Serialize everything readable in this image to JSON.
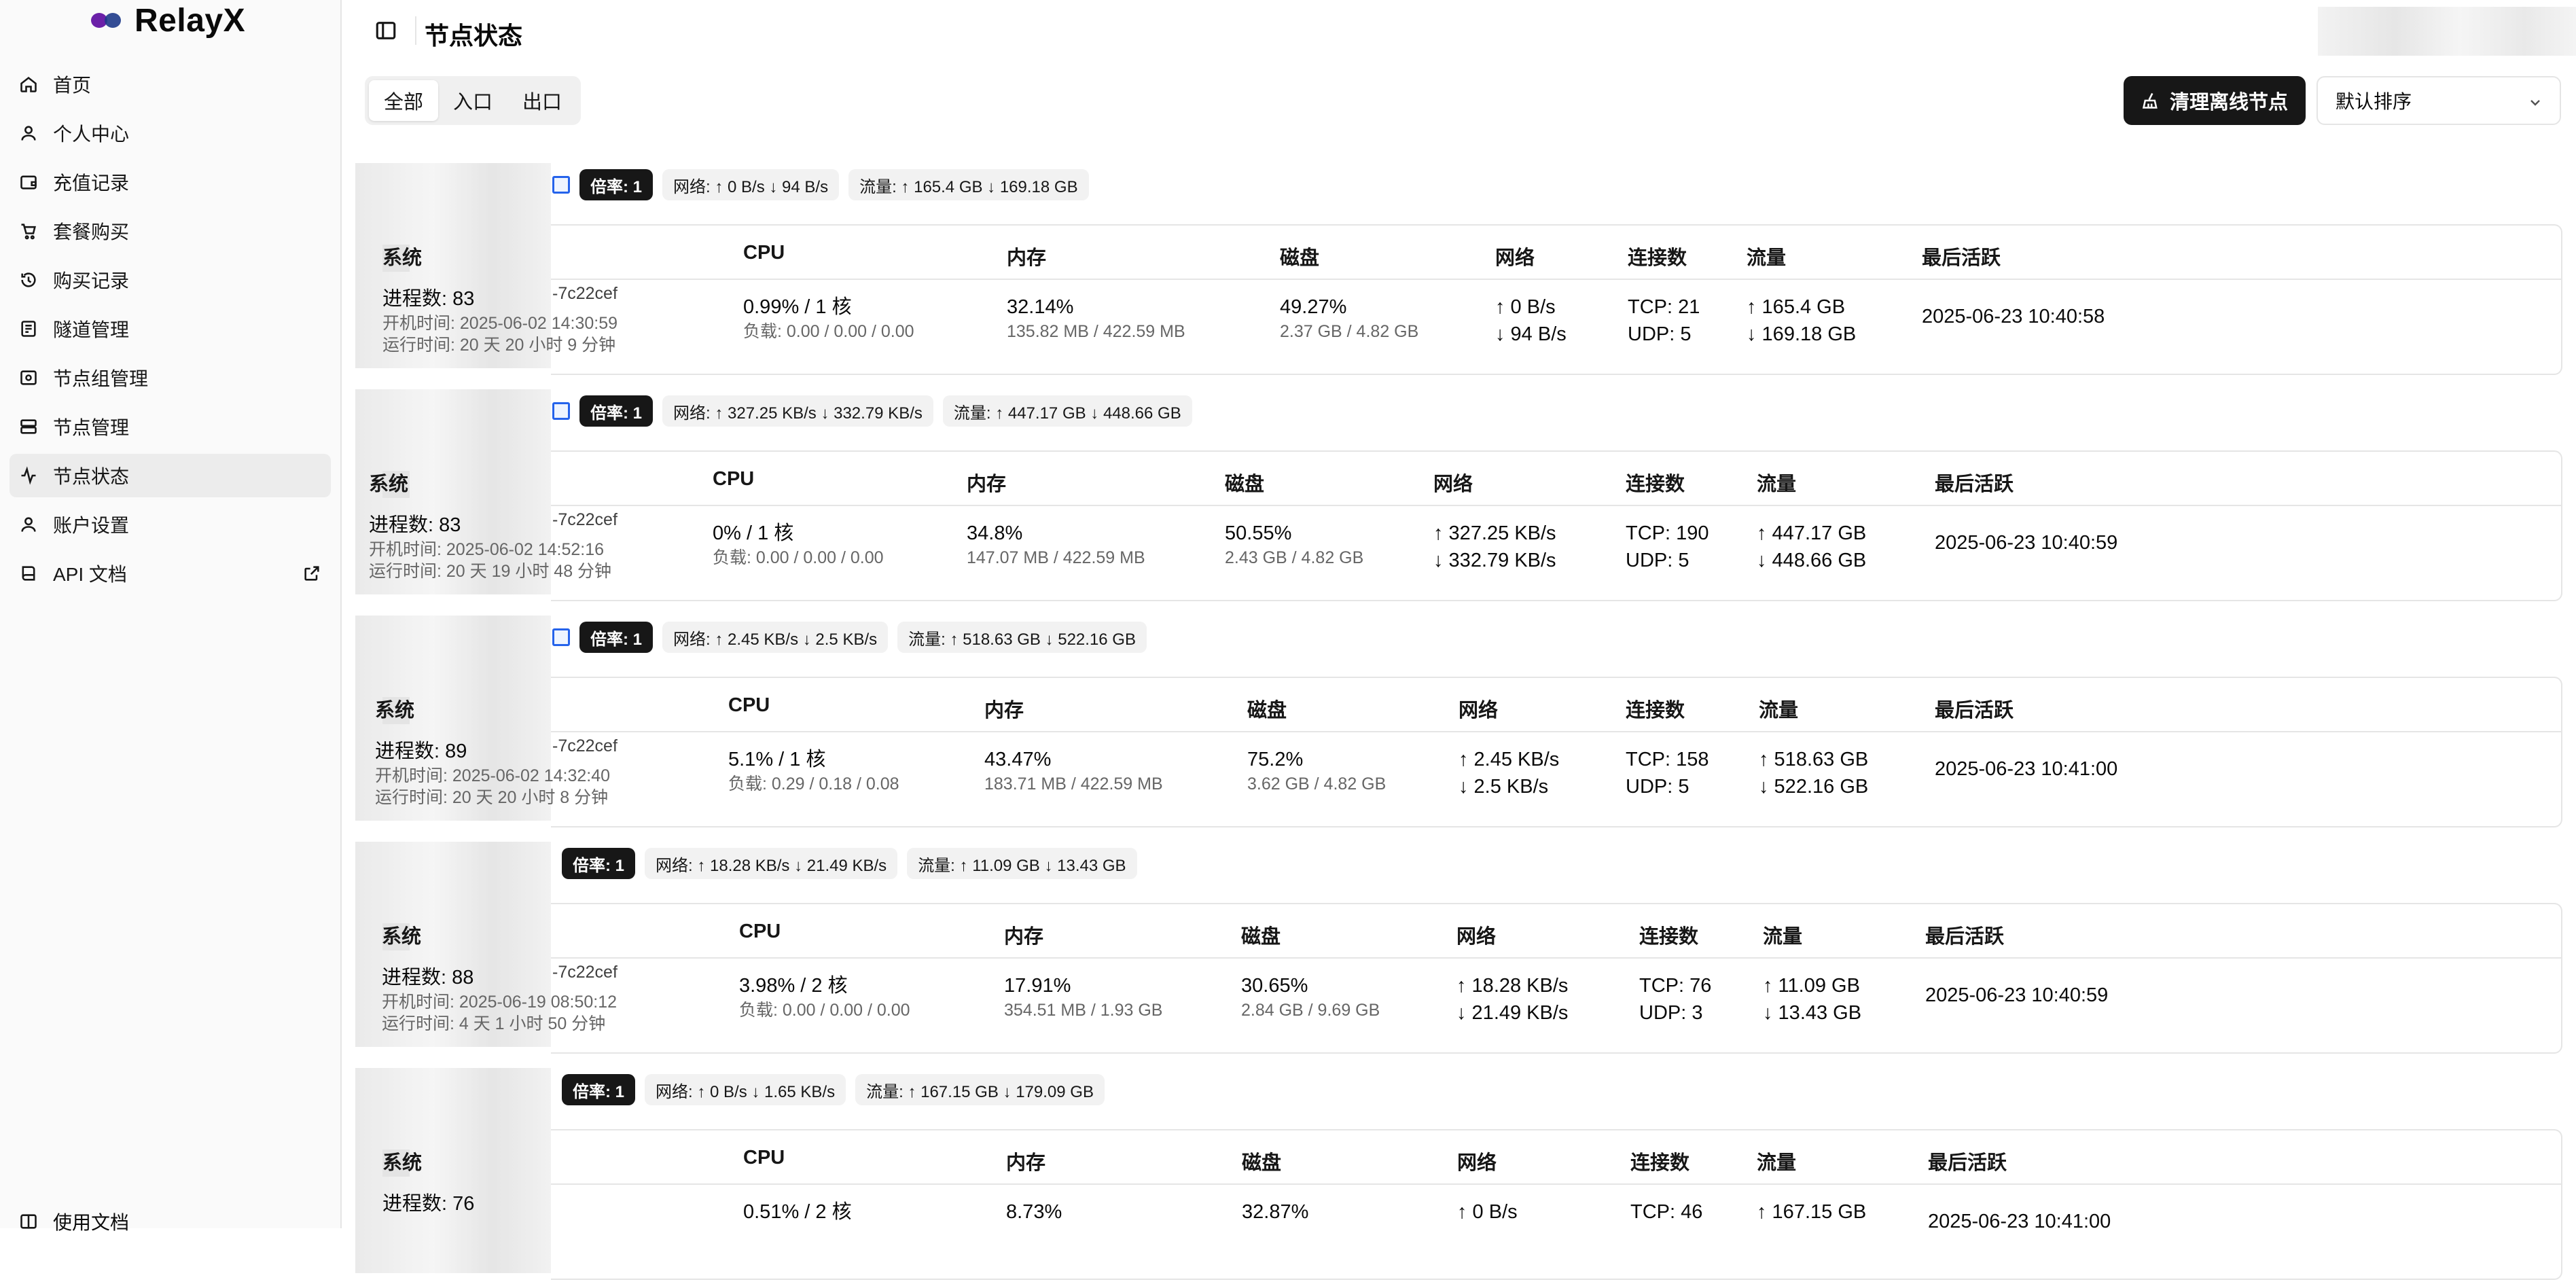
{
  "app": {
    "name": "RelayX"
  },
  "sidebar": {
    "items": [
      {
        "label": "首页",
        "icon": "home-icon"
      },
      {
        "label": "个人中心",
        "icon": "user-icon"
      },
      {
        "label": "充值记录",
        "icon": "wallet-icon"
      },
      {
        "label": "套餐购买",
        "icon": "cart-icon"
      },
      {
        "label": "购买记录",
        "icon": "history-icon"
      },
      {
        "label": "隧道管理",
        "icon": "tunnel-icon"
      },
      {
        "label": "节点组管理",
        "icon": "node-group-icon"
      },
      {
        "label": "节点管理",
        "icon": "server-icon"
      },
      {
        "label": "节点状态",
        "icon": "activity-icon"
      },
      {
        "label": "账户设置",
        "icon": "user-settings-icon"
      },
      {
        "label": "API 文档",
        "icon": "book-icon"
      }
    ],
    "bottom_label": "使用文档"
  },
  "header": {
    "title": "节点状态"
  },
  "toolbar": {
    "tabs": [
      "全部",
      "入口",
      "出口"
    ],
    "clean_label": "清理离线节点",
    "sort_value": "默认排序"
  },
  "columns": [
    "系统",
    "CPU",
    "内存",
    "磁盘",
    "网络",
    "连接数",
    "流量",
    "最后活跃"
  ],
  "nodes": [
    {
      "id_suffix": "-7c22cef",
      "rate": "倍率: 1",
      "net": "网络: ↑ 0 B/s ↓ 94 B/s",
      "traffic": "流量: ↑ 165.4 GB ↓ 169.18 GB",
      "proc": "进程数: 83",
      "boot": "开机时间: 2025-06-02 14:30:59",
      "uptime": "运行时间: 20 天 20 小时 9 分钟",
      "cpu": "0.99% / 1 核",
      "load": "负载: 0.00 / 0.00 / 0.00",
      "mem": "32.14%",
      "mem_sub": "135.82 MB / 422.59 MB",
      "disk": "49.27%",
      "disk_sub": "2.37 GB / 4.82 GB",
      "up": "↑ 0 B/s",
      "down": "↓ 94 B/s",
      "tcp": "TCP: 21",
      "udp": "UDP: 5",
      "t_up": "↑ 165.4 GB",
      "t_down": "↓ 169.18 GB",
      "last": "2025-06-23 10:40:58"
    },
    {
      "id_suffix": "-7c22cef",
      "rate": "倍率: 1",
      "net": "网络: ↑ 327.25 KB/s ↓ 332.79 KB/s",
      "traffic": "流量: ↑ 447.17 GB ↓ 448.66 GB",
      "proc": "进程数: 83",
      "boot": "开机时间: 2025-06-02 14:52:16",
      "uptime": "运行时间: 20 天 19 小时 48 分钟",
      "cpu": "0% / 1 核",
      "load": "负载: 0.00 / 0.00 / 0.00",
      "mem": "34.8%",
      "mem_sub": "147.07 MB / 422.59 MB",
      "disk": "50.55%",
      "disk_sub": "2.43 GB / 4.82 GB",
      "up": "↑ 327.25 KB/s",
      "down": "↓ 332.79 KB/s",
      "tcp": "TCP: 190",
      "udp": "UDP: 5",
      "t_up": "↑ 447.17 GB",
      "t_down": "↓ 448.66 GB",
      "last": "2025-06-23 10:40:59"
    },
    {
      "id_suffix": "-7c22cef",
      "rate": "倍率: 1",
      "net": "网络: ↑ 2.45 KB/s ↓ 2.5 KB/s",
      "traffic": "流量: ↑ 518.63 GB ↓ 522.16 GB",
      "proc": "进程数: 89",
      "boot": "开机时间: 2025-06-02 14:32:40",
      "uptime": "运行时间: 20 天 20 小时 8 分钟",
      "cpu": "5.1% / 1 核",
      "load": "负载: 0.29 / 0.18 / 0.08",
      "mem": "43.47%",
      "mem_sub": "183.71 MB / 422.59 MB",
      "disk": "75.2%",
      "disk_sub": "3.62 GB / 4.82 GB",
      "up": "↑ 2.45 KB/s",
      "down": "↓ 2.5 KB/s",
      "tcp": "TCP: 158",
      "udp": "UDP: 5",
      "t_up": "↑ 518.63 GB",
      "t_down": "↓ 522.16 GB",
      "last": "2025-06-23 10:41:00"
    },
    {
      "id_suffix": "-7c22cef",
      "rate": "倍率: 1",
      "net": "网络: ↑ 18.28 KB/s ↓ 21.49 KB/s",
      "traffic": "流量: ↑ 11.09 GB ↓ 13.43 GB",
      "proc": "进程数: 88",
      "boot": "开机时间: 2025-06-19 08:50:12",
      "uptime": "运行时间: 4 天 1 小时 50 分钟",
      "cpu": "3.98% / 2 核",
      "load": "负载: 0.00 / 0.00 / 0.00",
      "mem": "17.91%",
      "mem_sub": "354.51 MB / 1.93 GB",
      "disk": "30.65%",
      "disk_sub": "2.84 GB / 9.69 GB",
      "up": "↑ 18.28 KB/s",
      "down": "↓ 21.49 KB/s",
      "tcp": "TCP: 76",
      "udp": "UDP: 3",
      "t_up": "↑ 11.09 GB",
      "t_down": "↓ 13.43 GB",
      "last": "2025-06-23 10:40:59"
    },
    {
      "id_suffix": "",
      "rate": "倍率: 1",
      "net": "网络: ↑ 0 B/s ↓ 1.65 KB/s",
      "traffic": "流量: ↑ 167.15 GB ↓ 179.09 GB",
      "proc": "进程数: 76",
      "boot": "",
      "uptime": "",
      "cpu": "0.51% / 2 核",
      "load": "",
      "mem": "8.73%",
      "mem_sub": "",
      "disk": "32.87%",
      "disk_sub": "",
      "up": "↑ 0 B/s",
      "down": "",
      "tcp": "TCP: 46",
      "udp": "",
      "t_up": "↑ 167.15 GB",
      "t_down": "",
      "last": "2025-06-23 10:41:00"
    }
  ]
}
